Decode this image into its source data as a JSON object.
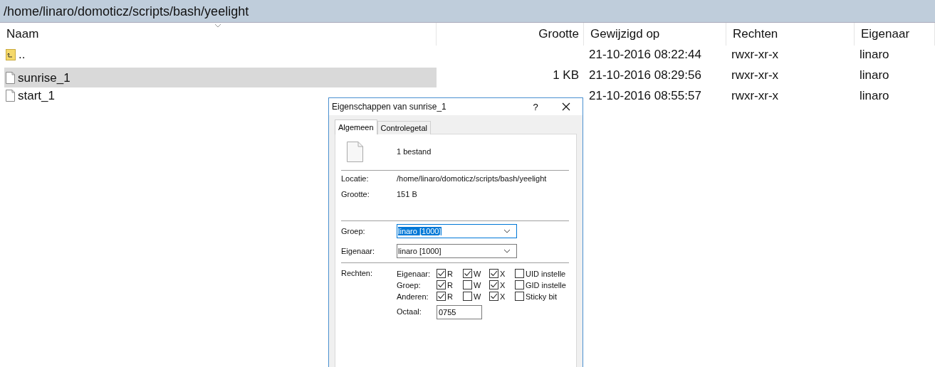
{
  "path_bar": {
    "path": "/home/linaro/domoticz/scripts/bash/yeelight"
  },
  "file_list": {
    "columns": [
      {
        "label": "Naam",
        "sorted": true
      },
      {
        "label": "Grootte",
        "sorted": false
      },
      {
        "label": "Gewijzigd op",
        "sorted": false
      },
      {
        "label": "Rechten",
        "sorted": false
      },
      {
        "label": "Eigenaar",
        "sorted": false
      }
    ],
    "rows": [
      {
        "kind": "parent",
        "name": "..",
        "modified": "21-10-2016 08:22:44",
        "permissions": "rwxr-xr-x",
        "owner": "linaro",
        "selected": false
      },
      {
        "kind": "file",
        "name": "sunrise_1",
        "size": "1 KB",
        "modified": "21-10-2016 08:29:56",
        "permissions": "rwxr-xr-x",
        "owner": "linaro",
        "selected": true
      },
      {
        "kind": "file",
        "name": "start_1",
        "modified": "21-10-2016 08:55:57",
        "permissions": "rwxr-xr-x",
        "owner": "linaro",
        "selected": false
      }
    ]
  },
  "dialog": {
    "title": "Eigenschappen van sunrise_1",
    "help": "?",
    "tabs": [
      {
        "label": "Algemeen",
        "selected": true
      },
      {
        "label": "Controlegetal",
        "selected": false
      }
    ],
    "file_count": "1 bestand",
    "info": [
      {
        "label": "Locatie:",
        "value": "/home/linaro/domoticz/scripts/bash/yeelight"
      },
      {
        "label": "Grootte:",
        "value": "151 B"
      }
    ],
    "selects": [
      {
        "label": "Groep:",
        "value": "linaro [1000]",
        "focused": true
      },
      {
        "label": "Eigenaar:",
        "value": "linaro [1000]",
        "focused": false
      }
    ],
    "permissions": {
      "label": "Rechten:",
      "rows": [
        {
          "label": "Eigenaar:",
          "bits": [
            {
              "label": "R",
              "checked": true
            },
            {
              "label": "W",
              "checked": true
            },
            {
              "label": "X",
              "checked": true
            },
            {
              "label": "UID instelle",
              "checked": false
            }
          ]
        },
        {
          "label": "Groep:",
          "bits": [
            {
              "label": "R",
              "checked": true
            },
            {
              "label": "W",
              "checked": false
            },
            {
              "label": "X",
              "checked": true
            },
            {
              "label": "GID instelle",
              "checked": false
            }
          ]
        },
        {
          "label": "Anderen:",
          "bits": [
            {
              "label": "R",
              "checked": true
            },
            {
              "label": "W",
              "checked": false
            },
            {
              "label": "X",
              "checked": true
            },
            {
              "label": "Sticky bit",
              "checked": false
            }
          ]
        }
      ]
    },
    "octal": {
      "label": "Octaal:",
      "value": "0755"
    }
  }
}
